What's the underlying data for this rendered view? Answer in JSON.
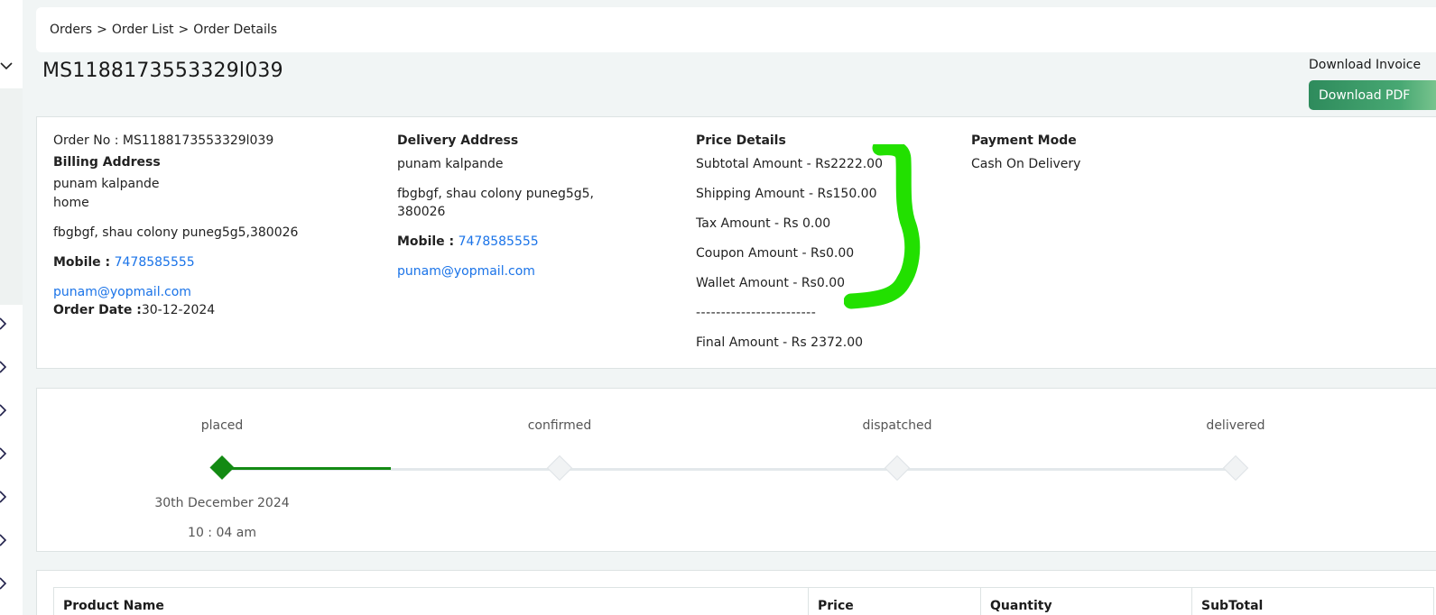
{
  "breadcrumb": {
    "items": [
      "Orders",
      "Order List",
      "Order Details"
    ],
    "separator": ">"
  },
  "order": {
    "title": "MS1188173553329l039"
  },
  "invoice": {
    "label": "Download Invoice",
    "button": "Download PDF"
  },
  "billing": {
    "order_no_label": "Order No :",
    "order_no": "MS1188173553329l039",
    "heading": "Billing Address",
    "name": "punam kalpande",
    "type": "home",
    "address": "fbgbgf, shau colony puneg5g5,380026",
    "mobile_label": "Mobile :",
    "mobile": "7478585555",
    "email": "punam@yopmail.com",
    "order_date_label": "Order Date :",
    "order_date": "30-12-2024"
  },
  "delivery": {
    "heading": "Delivery Address",
    "name": "punam kalpande",
    "address_line1": "fbgbgf, shau colony puneg5g5,",
    "address_line2": "380026",
    "mobile_label": "Mobile :",
    "mobile": "7478585555",
    "email": "punam@yopmail.com"
  },
  "price": {
    "heading": "Price Details",
    "subtotal": "Subtotal Amount - Rs2222.00",
    "shipping": "Shipping Amount - Rs150.00",
    "tax": "Tax Amount - Rs 0.00",
    "coupon": "Coupon Amount - Rs0.00",
    "wallet": "Wallet Amount - Rs0.00",
    "divider": "------------------------",
    "final": "Final Amount - Rs 2372.00"
  },
  "payment": {
    "heading": "Payment Mode",
    "mode": "Cash On Delivery"
  },
  "tracker": {
    "steps": [
      {
        "label": "placed",
        "done": true
      },
      {
        "label": "confirmed",
        "done": false
      },
      {
        "label": "dispatched",
        "done": false
      },
      {
        "label": "delivered",
        "done": false
      }
    ],
    "placed_date": "30th December 2024",
    "placed_time": "10 : 04 am"
  },
  "table": {
    "columns": [
      "Product Name",
      "Price",
      "Quantity",
      "SubTotal"
    ]
  },
  "colors": {
    "accent_green": "#138a13",
    "link_blue": "#1a73e8",
    "highlight_mark": "#22e000",
    "button_green": "#2e8b5c"
  }
}
